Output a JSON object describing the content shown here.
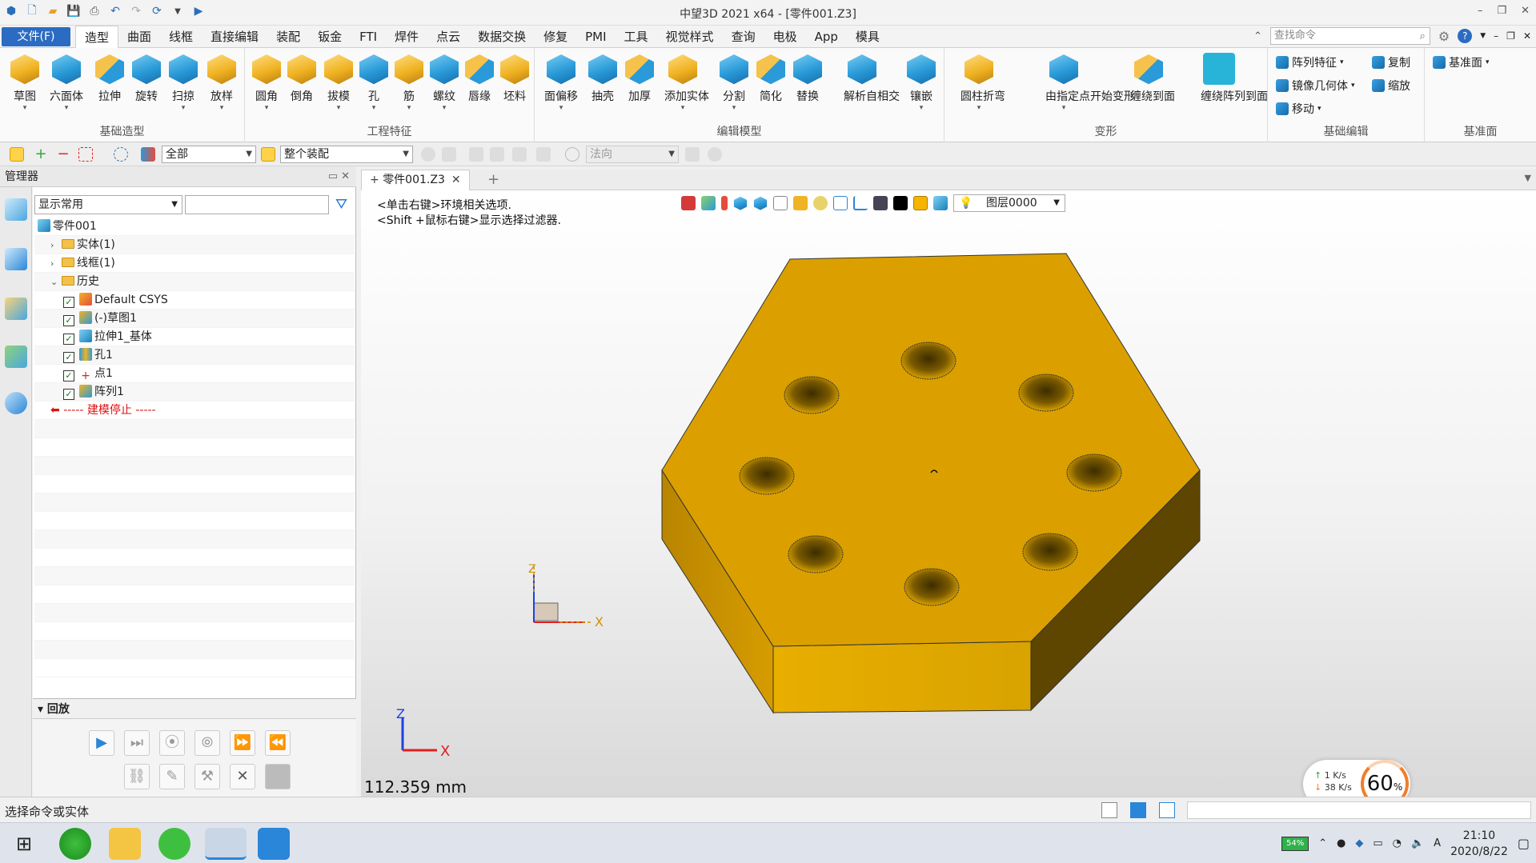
{
  "window": {
    "title": "中望3D 2021 x64 - [零件001.Z3]",
    "controls": [
      "–",
      "❐",
      "✕"
    ]
  },
  "menu": {
    "file": "文件(F)",
    "tabs": [
      "造型",
      "曲面",
      "线框",
      "直接编辑",
      "装配",
      "钣金",
      "FTI",
      "焊件",
      "点云",
      "数据交换",
      "修复",
      "PMI",
      "工具",
      "视觉样式",
      "查询",
      "电极",
      "App",
      "模具"
    ],
    "active_tab": "造型",
    "search_placeholder": "查找命令"
  },
  "ribbon": {
    "groups": [
      {
        "label": "基础造型",
        "buttons": [
          "草图",
          "六面体",
          "拉伸",
          "旋转",
          "扫掠",
          "放样"
        ]
      },
      {
        "label": "工程特征",
        "buttons": [
          "圆角",
          "倒角",
          "拔模",
          "孔",
          "筋",
          "螺纹",
          "唇缘",
          "坯料"
        ]
      },
      {
        "label": "编辑模型",
        "buttons": [
          "面偏移",
          "抽壳",
          "加厚",
          "添加实体",
          "分割",
          "简化",
          "替换",
          "解析自相交",
          "镶嵌"
        ]
      },
      {
        "label": "变形",
        "buttons": [
          "圆柱折弯",
          "由指定点开始变形",
          "缠绕到面",
          "缠绕阵列到面"
        ]
      },
      {
        "label": "基础编辑",
        "items": [
          "阵列特征",
          "镜像几何体",
          "移动",
          "复制",
          "缩放"
        ]
      },
      {
        "label": "基准面",
        "items": [
          "基准面"
        ]
      }
    ]
  },
  "toolbar2": {
    "filter": "全部",
    "scope": "整个装配",
    "direction": "法向"
  },
  "manager": {
    "title": "管理器",
    "filter": "显示常用",
    "tree": [
      {
        "label": "零件001",
        "indent": 0,
        "kind": "root"
      },
      {
        "label": "实体(1)",
        "indent": 1,
        "kind": "folder",
        "expander": "›"
      },
      {
        "label": "线框(1)",
        "indent": 1,
        "kind": "folder",
        "expander": "›"
      },
      {
        "label": "历史",
        "indent": 1,
        "kind": "folder",
        "expander": "⌄"
      },
      {
        "label": "Default CSYS",
        "indent": 2,
        "kind": "item",
        "checked": true,
        "icon": "csys-icon"
      },
      {
        "label": "(-)草图1",
        "indent": 2,
        "kind": "item",
        "checked": true,
        "icon": "sketch-icon"
      },
      {
        "label": "拉伸1_基体",
        "indent": 2,
        "kind": "item",
        "checked": true,
        "icon": "extrude-icon"
      },
      {
        "label": "孔1",
        "indent": 2,
        "kind": "item",
        "checked": true,
        "icon": "hole-icon"
      },
      {
        "label": "点1",
        "indent": 2,
        "kind": "item",
        "checked": true,
        "icon": "point-icon"
      },
      {
        "label": "阵列1",
        "indent": 2,
        "kind": "item",
        "checked": true,
        "icon": "pattern-icon"
      },
      {
        "label": "----- 建模停止 -----",
        "indent": 1,
        "kind": "stop"
      }
    ],
    "playback_title": "回放"
  },
  "document": {
    "tab": "零件001.Z3",
    "hint1": "<单击右键>环境相关选项.",
    "hint2": "<Shift +鼠标右键>显示选择过滤器.",
    "layer": "图层0000",
    "measure": "112.359 mm",
    "axis_x": "X",
    "axis_z": "Z"
  },
  "status": {
    "prompt": "选择命令或实体"
  },
  "speed_widget": {
    "up": "1  K/s",
    "down": "38  K/s",
    "percent": "60",
    "percent_unit": "%"
  },
  "taskbar": {
    "battery": "54%",
    "time": "21:10",
    "date": "2020/8/22"
  },
  "colors": {
    "part_top": "#DBA000",
    "part_side_dark": "#5E4600",
    "part_side_front": "#E0A800",
    "accent": "#2B6CC2"
  }
}
